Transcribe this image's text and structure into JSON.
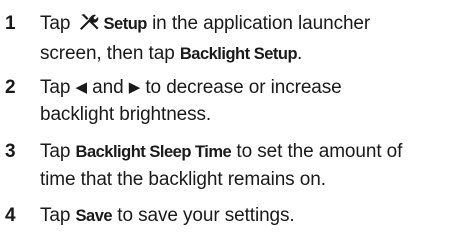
{
  "steps": [
    {
      "number": "1",
      "parts": {
        "a": "Tap",
        "b": "Setup",
        "c": "in the application launcher",
        "d": "screen, then tap",
        "e": "Backlight Setup",
        "f": "."
      },
      "icon": "tools-icon"
    },
    {
      "number": "2",
      "parts": {
        "a": "Tap",
        "left": "◀",
        "b": "and",
        "right": "▶",
        "c": "to decrease or increase",
        "d": "backlight brightness."
      }
    },
    {
      "number": "3",
      "parts": {
        "a": "Tap",
        "b": "Backlight Sleep Time",
        "c": "to set the amount of",
        "d": "time that the backlight remains on."
      }
    },
    {
      "number": "4",
      "parts": {
        "a": "Tap",
        "b": "Save",
        "c": "to save your settings."
      }
    }
  ]
}
